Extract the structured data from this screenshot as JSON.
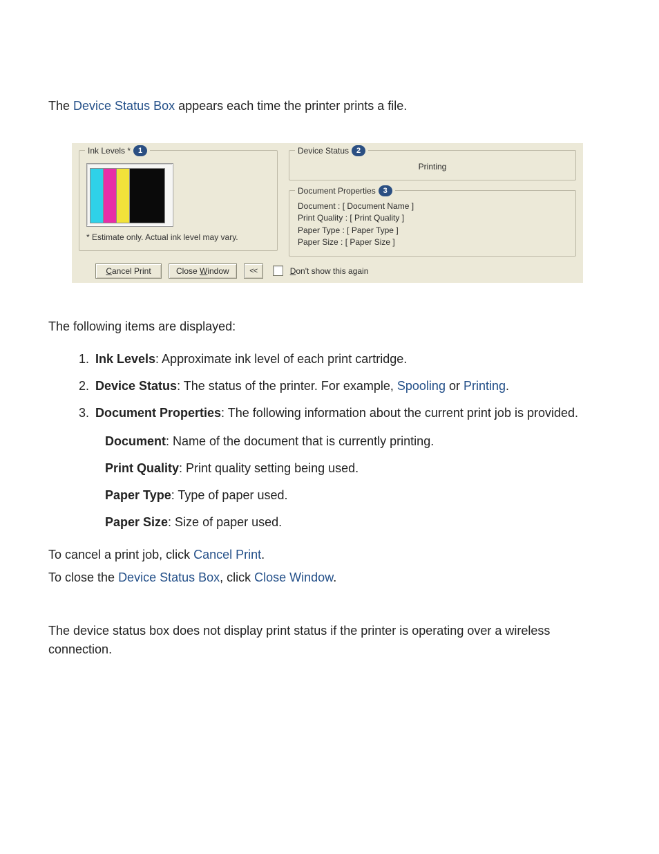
{
  "intro": {
    "before_link": "The ",
    "link_text": "Device Status Box",
    "after_link": " appears each time the printer prints a file."
  },
  "dialog": {
    "ink": {
      "legend": "Ink Levels *",
      "callout": "1",
      "note": "* Estimate only.  Actual ink level may vary."
    },
    "status": {
      "legend": "Device Status",
      "callout": "2",
      "value": "Printing"
    },
    "doc": {
      "legend": "Document Properties",
      "callout": "3",
      "rows": {
        "r0": "Document :  [ Document Name ]",
        "r1": "Print Quality :  [ Print Quality ]",
        "r2": "Paper Type :  [ Paper Type ]",
        "r3": "Paper Size :  [ Paper Size ]"
      }
    },
    "buttons": {
      "cancel_under": "C",
      "cancel_rest": "ancel Print",
      "close_pre": "Close ",
      "close_under": "W",
      "close_rest": "indow",
      "collapse": "<<"
    },
    "checkbox": {
      "under": "D",
      "rest": "on't show this again"
    }
  },
  "explain": {
    "lead": "The following items are displayed:",
    "items": {
      "ink_title": "Ink Levels",
      "ink_desc": ": Approximate ink level of each print cartridge.",
      "status_title": "Device Status",
      "status_desc_pre": ": The status of the printer. For example, ",
      "status_link1": "Spooling",
      "status_desc_mid": " or ",
      "status_link2": "Printing",
      "status_desc_post": ".",
      "doc_title": "Document Properties",
      "doc_desc": ": The following information about the current print job is provided.",
      "sub": {
        "doc_t": "Document",
        "doc_d": ": Name of the document that is currently printing.",
        "pq_t": "Print Quality",
        "pq_d": ": Print quality setting being used.",
        "pt_t": "Paper Type",
        "pt_d": ": Type of paper used.",
        "ps_t": "Paper Size",
        "ps_d": ": Size of paper used."
      }
    }
  },
  "closing": {
    "cancel_pre": "To cancel a print job, click ",
    "cancel_link": "Cancel Print",
    "cancel_post": ".",
    "close_pre": "To close the ",
    "close_link1": "Device Status Box",
    "close_mid": ", click ",
    "close_link2": "Close Window",
    "close_post": "."
  },
  "note": "The device status box does not display print status if the printer is operating over a wireless connection."
}
